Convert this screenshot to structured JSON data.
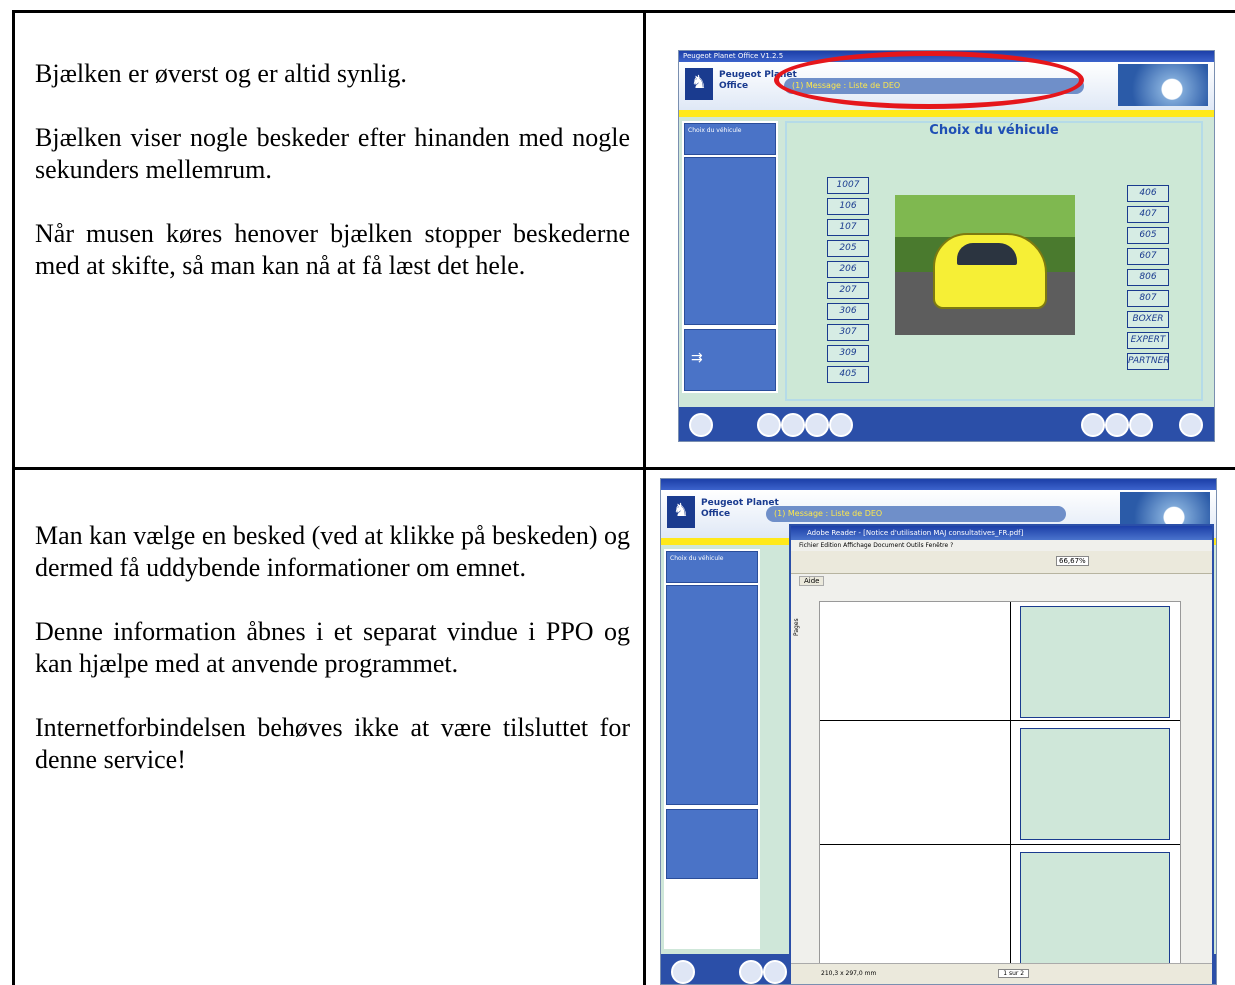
{
  "row1": {
    "paragraphs": [
      "Bjælken er øverst og er altid synlig.",
      "Bjælken viser nogle beskeder efter hinanden med nogle sekunders mellemrum.",
      "Når musen køres henover bjælken stopper beskederne med at skifte, så man kan  nå at få læst det hele."
    ]
  },
  "row2": {
    "paragraphs": [
      "Man kan vælge en besked (ved at klikke på beskeden) og dermed få uddybende informationer om emnet.",
      "Denne information åbnes i et separat vindue i PPO og kan hjælpe med at anvende programmet.",
      "Internetforbindelsen behøves ikke at være tilsluttet for denne service!"
    ]
  },
  "screenshot_top": {
    "window_title": "Peugeot Planet Office V1.2.5",
    "app_name_1": "Peugeot Planet",
    "app_name_2": "Office",
    "message_bar": "(1) Message : Liste de DEO",
    "sidebar_tab": "Choix du véhicule",
    "heading": "Choix du véhicule",
    "models_left": [
      "1007",
      "106",
      "107",
      "205",
      "206",
      "207",
      "306",
      "307",
      "309",
      "405"
    ],
    "models_right": [
      "406",
      "407",
      "605",
      "607",
      "806",
      "807",
      "BOXER",
      "EXPERT",
      "PARTNER"
    ],
    "accent_colors": {
      "highlight": "#e5161b",
      "band": "#ffe91a",
      "brand": "#1a3b8f"
    }
  },
  "screenshot_bottom": {
    "reader_title": "Adobe Reader - [Notice d'utilisation MAJ consultatives_FR.pdf]",
    "reader_menu": "Fichier  Edition  Affichage  Document  Outils  Fenêtre  ?",
    "zoom": "66,67%",
    "help_button": "Aide",
    "sidebar_tab_pages": "Pages",
    "page_size": "210,3 x 297,0 mm",
    "page_counter": "1 sur 2"
  }
}
